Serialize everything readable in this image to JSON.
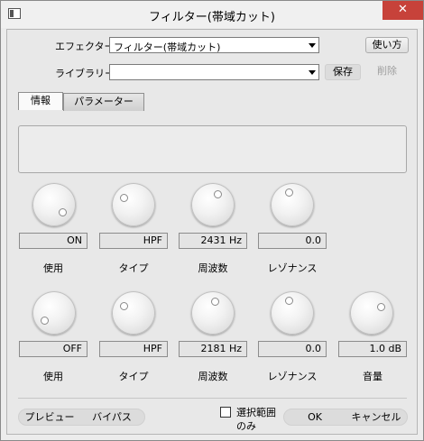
{
  "window": {
    "title": "フィルター(帯域カット)",
    "close_glyph": "✕"
  },
  "effector": {
    "label": "エフェクター",
    "value": "フィルター(帯域カット)",
    "usage_button": "使い方"
  },
  "library": {
    "label": "ライブラリー",
    "value": "",
    "save_button": "保存",
    "delete_button": "削除"
  },
  "tabs": [
    {
      "label": "情報"
    },
    {
      "label": "パラメーター"
    }
  ],
  "rows": [
    {
      "params": [
        {
          "value": "ON",
          "label": "使用"
        },
        {
          "value": "HPF",
          "label": "タイプ"
        },
        {
          "value": "2431 Hz",
          "label": "周波数"
        },
        {
          "value": "0.0",
          "label": "レゾナンス"
        }
      ]
    },
    {
      "params": [
        {
          "value": "OFF",
          "label": "使用"
        },
        {
          "value": "HPF",
          "label": "タイプ"
        },
        {
          "value": "2181 Hz",
          "label": "周波数"
        },
        {
          "value": "0.0",
          "label": "レゾナンス"
        },
        {
          "value": "1.0 dB",
          "label": "音量"
        }
      ]
    }
  ],
  "footer": {
    "preview_button": "プレビュー",
    "bypass_button": "バイパス",
    "selection_only_label_1": "選択範囲",
    "selection_only_label_2": "のみ",
    "ok_button": "OK",
    "cancel_button": "キャンセル"
  }
}
